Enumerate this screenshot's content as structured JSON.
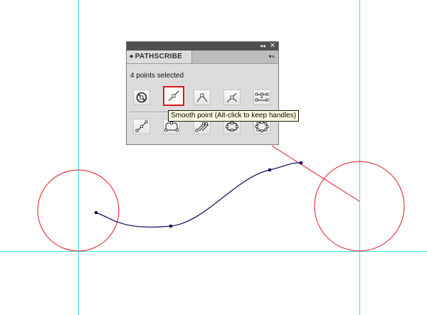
{
  "app": {
    "panel_title": "PATHSCRIBE",
    "tab_arrows_glyph": "◆",
    "collapse_glyph": "◂◂",
    "close_glyph": "✕",
    "menu_glyph": "▾≡"
  },
  "status_text": "4 points selected",
  "tooltip_text": "Smooth point (Alt-click to keep handles)",
  "toolbar_row1": [
    {
      "icon": "no-convert-icon",
      "selected": false
    },
    {
      "icon": "smooth-point-icon",
      "selected": true
    },
    {
      "icon": "corner-point-icon",
      "selected": false
    },
    {
      "icon": "cusp-point-icon",
      "selected": false
    },
    {
      "icon": "distribute-points-icon",
      "selected": false
    }
  ],
  "toolbar_row2": [
    {
      "icon": "straighten-handles-icon"
    },
    {
      "icon": "smooth-curve-icon"
    },
    {
      "icon": "retract-handles-icon"
    },
    {
      "icon": "round-rect-icon"
    },
    {
      "icon": "ellipse-icon"
    }
  ],
  "colors": {
    "guide": "#38e0e0",
    "circle": "#e2141c",
    "path": "#0a0a5a",
    "selection_border": "#e2141c",
    "panel_bg": "#dcdcdc",
    "titlebar": "#505050",
    "tooltip_bg": "#ffffe1"
  }
}
